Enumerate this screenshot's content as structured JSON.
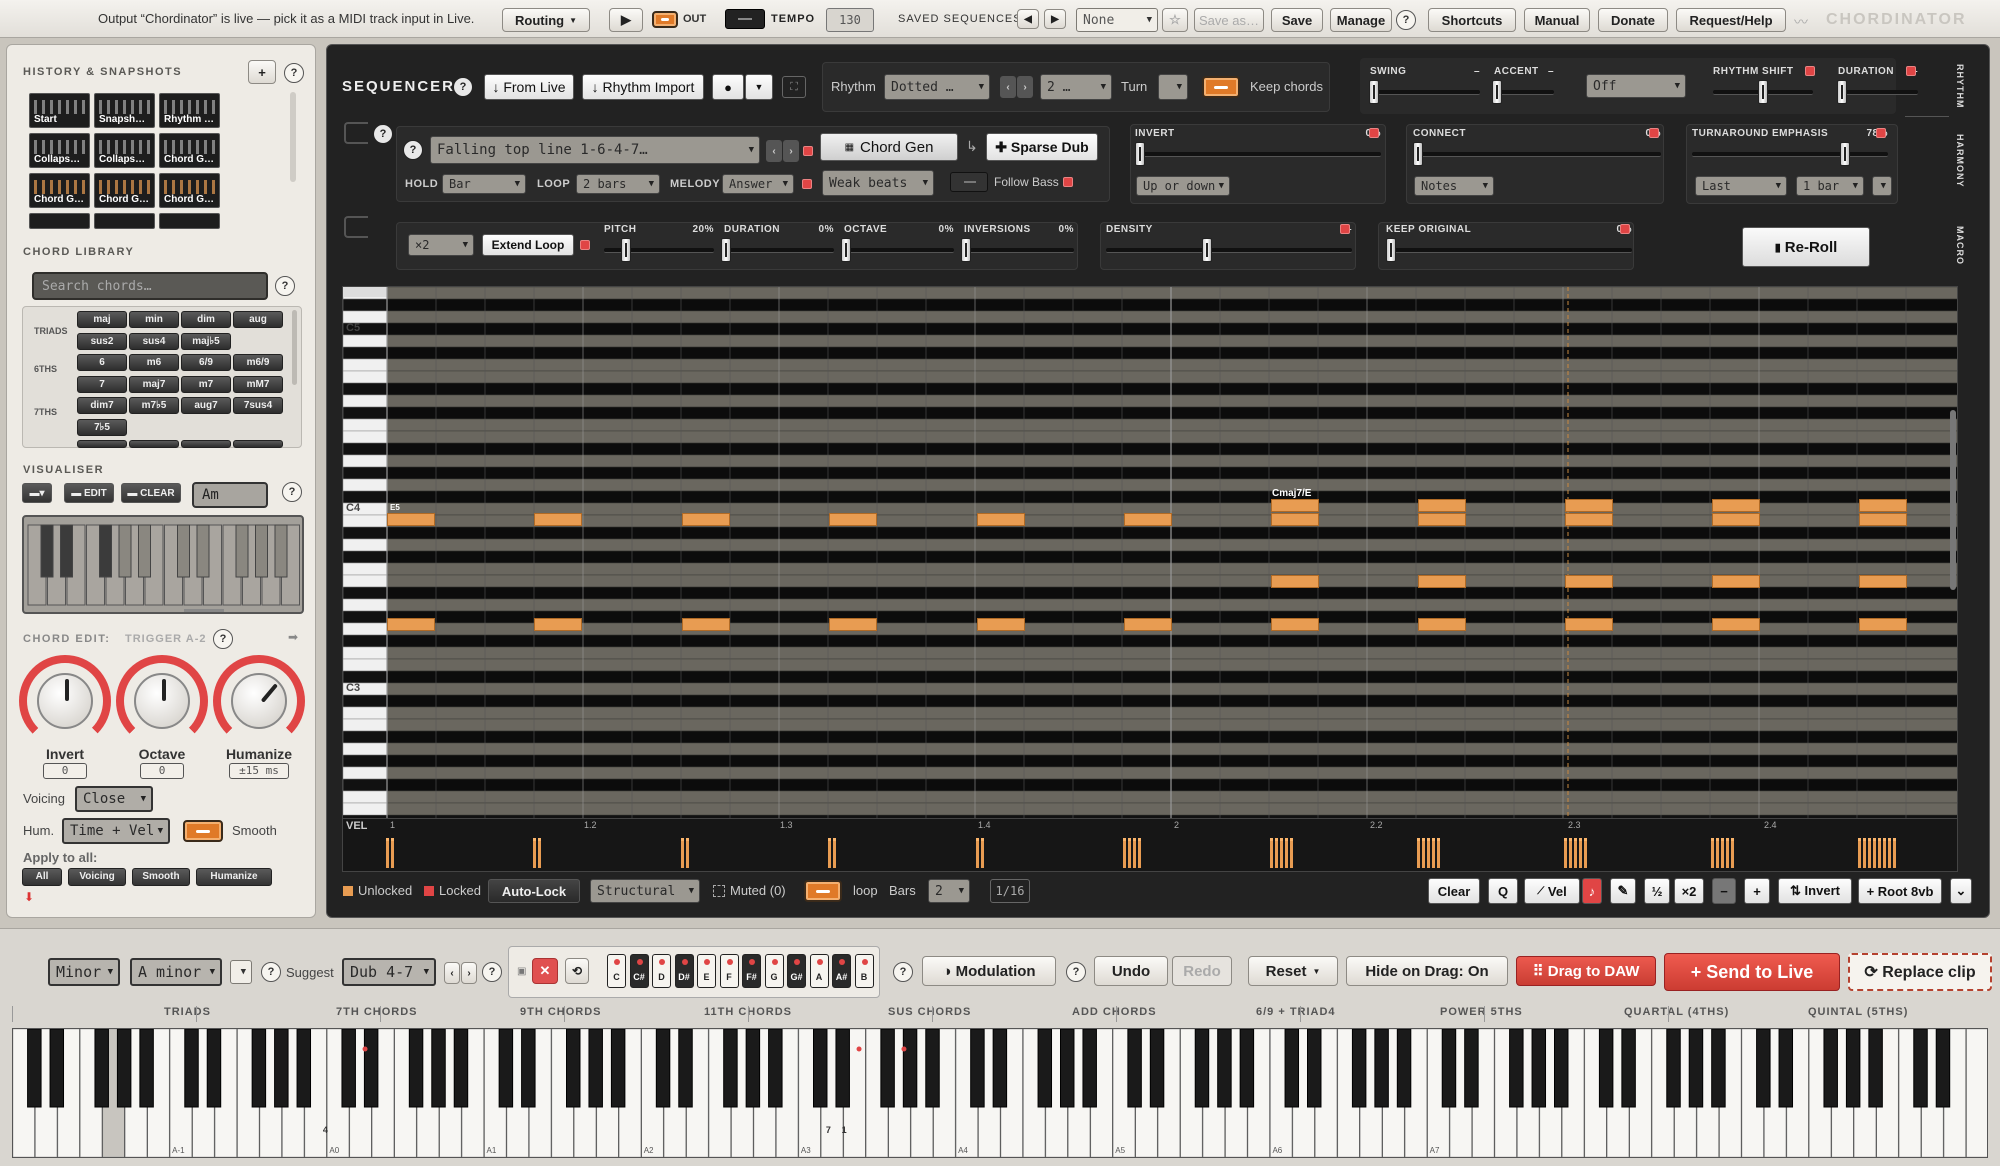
{
  "topbar": {
    "status": "Output “Chordinator” is live — pick it as a MIDI track input in Live.",
    "routing": "Routing",
    "out": "OUT",
    "tempo_label": "TEMPO",
    "tempo_value": "130",
    "saved_label": "SAVED SEQUENCES",
    "saved_select": "None",
    "save_as": "Save as…",
    "save": "Save",
    "manage": "Manage",
    "shortcuts": "Shortcuts",
    "manual": "Manual",
    "donate": "Donate",
    "request": "Request/Help",
    "logo": "CHORDINATOR"
  },
  "left": {
    "history_title": "HISTORY & SNAPSHOTS",
    "snapshots": [
      "Start",
      "Snapsh…",
      "Rhythm …",
      "Collaps…",
      "Collaps…",
      "Chord G…",
      "Chord G…",
      "Chord G…",
      "Chord G…"
    ],
    "library_title": "CHORD LIBRARY",
    "search_placeholder": "Search chords…",
    "rows": [
      {
        "label": "TRIADS",
        "chords": [
          "maj",
          "min",
          "dim",
          "aug"
        ]
      },
      {
        "label": "",
        "chords": [
          "sus2",
          "sus4",
          "maj♭5"
        ]
      },
      {
        "label": "6THS",
        "chords": [
          "6",
          "m6",
          "6/9",
          "m6/9"
        ]
      },
      {
        "label": "",
        "chords": [
          "7",
          "maj7",
          "m7",
          "mM7"
        ]
      },
      {
        "label": "7THS",
        "chords": [
          "dim7",
          "m7♭5",
          "aug7",
          "7sus4"
        ]
      },
      {
        "label": "",
        "chords": [
          "7♭5"
        ]
      }
    ],
    "visualiser_title": "VISUALISER",
    "edit": "EDIT",
    "clear": "CLEAR",
    "chord_input": "Am",
    "chord_edit_title": "CHORD EDIT:",
    "trigger": "TRIGGER A-2",
    "knobs": [
      {
        "label": "Invert",
        "value": "0"
      },
      {
        "label": "Octave",
        "value": "0"
      },
      {
        "label": "Humanize",
        "value": "±15 ms"
      }
    ],
    "voicing_label": "Voicing",
    "voicing": "Close",
    "hum_label": "Hum.",
    "hum": "Time + Vel",
    "smooth": "Smooth",
    "apply_label": "Apply to all:",
    "apply": [
      "All",
      "Voicing",
      "Smooth",
      "Humanize"
    ]
  },
  "seq": {
    "title": "SEQUENCER",
    "from_live": "↓ From Live",
    "rhythm_import": "↓ Rhythm Import",
    "rhythm_label": "Rhythm",
    "rhythm_sel": "Dotted …",
    "rhythm_num": "2 …",
    "turn_label": "Turn",
    "keep_chords": "Keep chords",
    "swing": "SWING",
    "swing_val": "–",
    "accent": "ACCENT",
    "accent_val": "–",
    "accent_sel": "Off",
    "rhythm_shift": "RHYTHM SHIFT",
    "rhythm_shift_val": "–",
    "duration": "DURATION",
    "duration_val": "–",
    "preset": "Falling top line 1-6-4-7…",
    "chord_gen": "Chord Gen",
    "sparse_dub": "✚ Sparse Dub",
    "hold_label": "HOLD",
    "hold": "Bar",
    "loop_label": "LOOP",
    "loop": "2 bars",
    "melody_label": "MELODY",
    "melody": "Answer",
    "weak": "Weak beats",
    "follow_bass": "Follow Bass",
    "invert": "INVERT",
    "invert_val": "0%",
    "invert_sel": "Up or down",
    "connect": "CONNECT",
    "connect_val": "0%",
    "connect_sel": "Notes",
    "turn_emph": "TURNAROUND EMPHASIS",
    "turn_emph_val": "78%",
    "turn_sel1": "Last",
    "turn_sel2": "1 bar",
    "mult": "×2",
    "extend_loop": "Extend Loop",
    "pitch": "PITCH",
    "pitch_val": "20%",
    "dur2": "DURATION",
    "dur2_val": "0%",
    "octave": "OCTAVE",
    "octave_val": "0%",
    "inversions": "INVERSIONS",
    "inversions_val": "0%",
    "density": "DENSITY",
    "density_val": "–",
    "keep_orig": "KEEP ORIGINAL",
    "keep_orig_val": "0%",
    "reroll": "Re-Roll",
    "tabs": [
      "RHYTHM",
      "HARMONY",
      "MACRO"
    ]
  },
  "roll": {
    "c5": "C5",
    "c4": "C4",
    "c3": "C3",
    "chord_label": "Cmaj7/E",
    "e5": "E5",
    "vel": "VEL",
    "markers": [
      "1",
      "1.2",
      "1.3",
      "1.4",
      "2",
      "2.2",
      "2.3",
      "2.4"
    ]
  },
  "seqbottom": {
    "unlocked": "Unlocked",
    "locked": "Locked",
    "auto_lock": "Auto-Lock",
    "structural": "Structural",
    "muted": "Muted (0)",
    "loop": "loop",
    "bars": "Bars",
    "bars_val": "2",
    "grid": "1/16",
    "clear": "Clear",
    "q": "Q",
    "vel": "Vel",
    "half": "½",
    "x2": "×2",
    "minus": "−",
    "plus": "+",
    "invert": "⇅ Invert",
    "root8vb": "+ Root 8vb"
  },
  "bottom": {
    "mode": "Minor",
    "key": "A minor",
    "suggest_label": "Suggest",
    "suggest": "Dub 4-7",
    "notes": [
      "C",
      "C#",
      "D",
      "D#",
      "E",
      "F",
      "F#",
      "G",
      "G#",
      "A",
      "A#",
      "B"
    ],
    "modulation": "◑ Modulation",
    "undo": "Undo",
    "redo": "Redo",
    "reset": "Reset",
    "hide_drag": "Hide on Drag: On",
    "drag_daw": "⠿ Drag to DAW",
    "send_live": "+ Send to Live",
    "replace": "⟳ Replace clip",
    "categories": [
      "TRIADS",
      "7TH CHORDS",
      "9TH CHORDS",
      "11TH CHORDS",
      "SUS CHORDS",
      "ADD CHORDS",
      "6/9 + TRIAD4",
      "POWER 5THS",
      "QUARTAL (4THS)",
      "QUINTAL (5THS)"
    ],
    "key_labels": [
      "A-1",
      "A0",
      "A1",
      "A2",
      "A3",
      "A4",
      "A5",
      "A6",
      "A7"
    ],
    "key_nums": [
      "4",
      "7",
      "1"
    ]
  }
}
